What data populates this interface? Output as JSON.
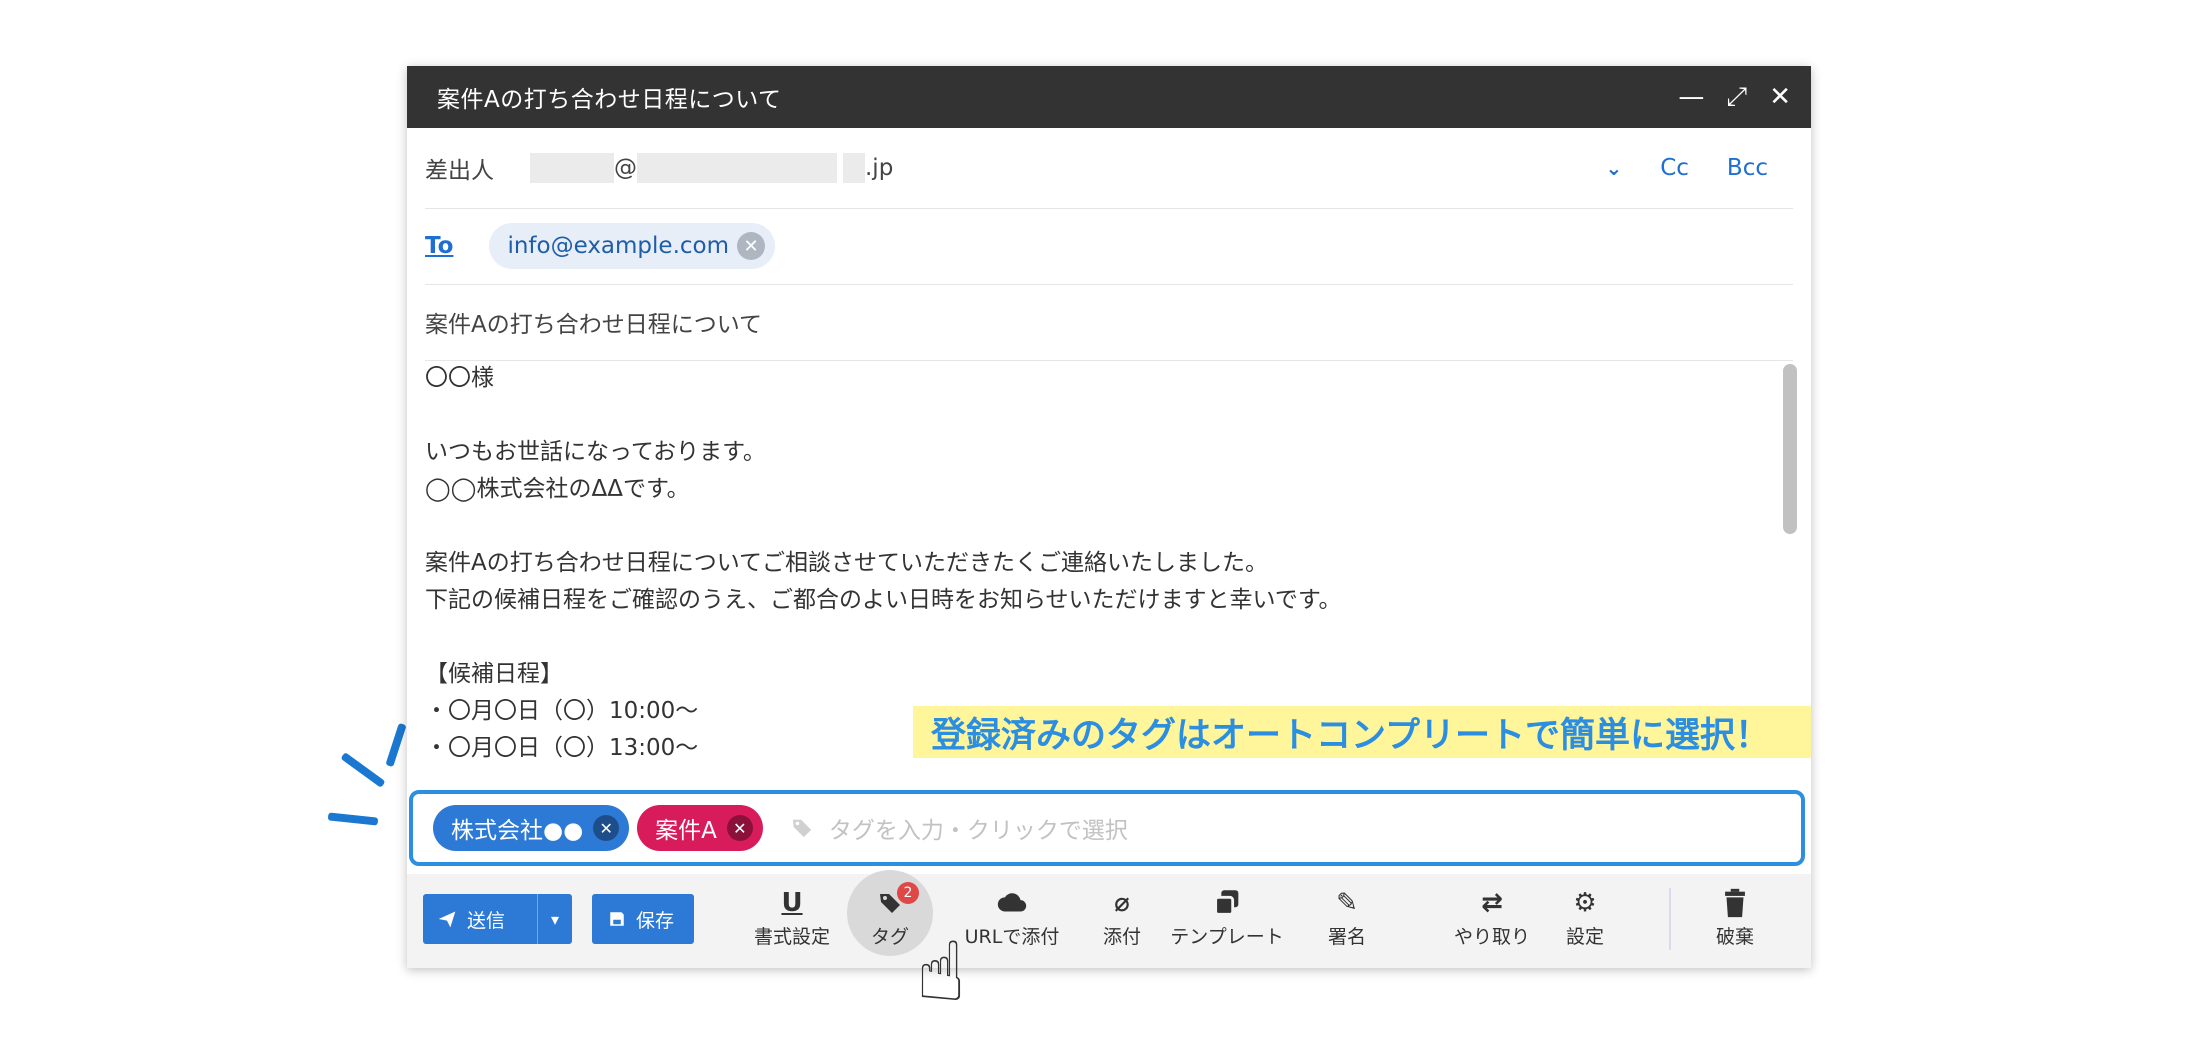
{
  "window": {
    "title": "案件Aの打ち合わせ日程について",
    "minimize_glyph": "—",
    "expand_glyph": "⤢",
    "close_glyph": "✕"
  },
  "from": {
    "label": "差出人",
    "at": "@",
    "domain_suffix": ".jp",
    "chevron": "⌄",
    "cc": "Cc",
    "bcc": "Bcc"
  },
  "to": {
    "label": "To",
    "recipient": "info@example.com",
    "remove_glyph": "✕"
  },
  "subject": "案件Aの打ち合わせ日程について",
  "body_lines": [
    "〇〇様",
    "",
    "いつもお世話になっております。",
    "◯◯株式会社のΔΔです。",
    "",
    "案件Aの打ち合わせ日程についてご相談させていただきたくご連絡いたしました。",
    "下記の候補日程をご確認のうえ、ご都合のよい日時をお知らせいただけますと幸いです。",
    "",
    "【候補日程】",
    "・〇月〇日（〇）10:00〜",
    "・〇月〇日（〇）13:00〜"
  ],
  "tags": {
    "items": [
      {
        "label": "株式会社●●",
        "color": "#2d79d6"
      },
      {
        "label": "案件A",
        "color": "#d81b5a"
      }
    ],
    "remove_glyph": "✕",
    "placeholder": "タグを入力・クリックで選択",
    "border_color": "#2d8fe0"
  },
  "toolbar": {
    "send_label": "送信",
    "send_dropdown": "▾",
    "save_label": "保存",
    "format_label": "書式設定",
    "tag_label": "タグ",
    "tag_badge": "2",
    "url_attach_label": "URLで添付",
    "attach_label": "添付",
    "template_label": "テンプレート",
    "signature_label": "署名",
    "thread_label": "やり取り",
    "settings_label": "設定",
    "discard_label": "破棄"
  },
  "callout": {
    "text": "登録済みのタグはオートコンプリートで簡単に選択！",
    "bg": "#fff59b",
    "color": "#2b8ee0"
  },
  "colors": {
    "accent": "#2d79d6",
    "titlebar": "#333333"
  }
}
